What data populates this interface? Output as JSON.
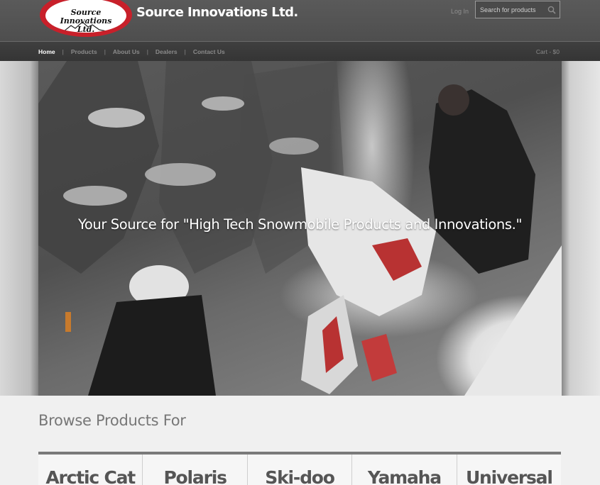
{
  "header": {
    "logo_text_line1": "Source Innovations",
    "logo_text_line2": "Ltd.",
    "brand_name": "Source Innovations Ltd.",
    "login_label": "Log In",
    "search_placeholder": "Search for products"
  },
  "nav": {
    "items": [
      {
        "label": "Home",
        "active": true
      },
      {
        "label": "Products",
        "active": false
      },
      {
        "label": "About Us",
        "active": false
      },
      {
        "label": "Dealers",
        "active": false
      },
      {
        "label": "Contact Us",
        "active": false
      }
    ],
    "separator": "|",
    "cart_label": "Cart - $0"
  },
  "hero": {
    "tagline": "Your Source for \"High Tech Snowmobile Products and Innovations.\""
  },
  "browse": {
    "heading": "Browse Products For",
    "brands": [
      "Arctic Cat",
      "Polaris",
      "Ski-doo",
      "Yamaha",
      "Universal"
    ]
  },
  "colors": {
    "logo_red": "#c8202a",
    "header_bg": "#555555",
    "nav_bg": "#3a3a3a",
    "brand_text": "#555555"
  },
  "icons": {
    "search": "search-icon",
    "logo_mountain": "mountain-icon"
  }
}
